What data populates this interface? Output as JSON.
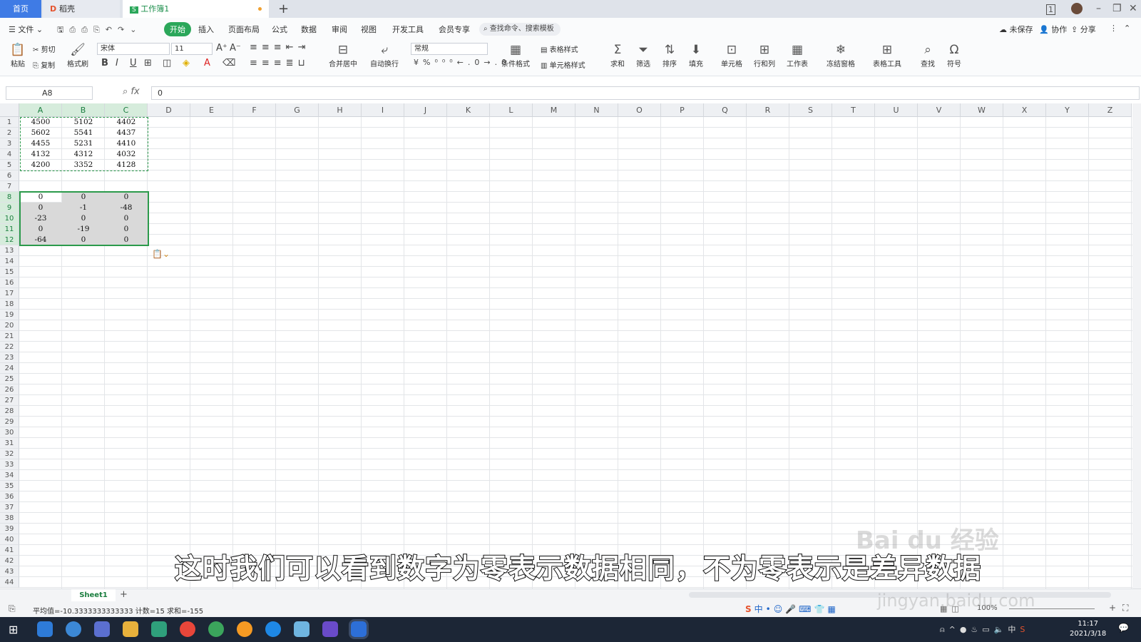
{
  "tabs": {
    "home": "首页",
    "daoke": "稻壳",
    "workbook": "工作簿1"
  },
  "menu": {
    "file": "文件",
    "start": "开始",
    "insert": "插入",
    "layout": "页面布局",
    "formula": "公式",
    "data": "数据",
    "review": "审阅",
    "view": "视图",
    "dev": "开发工具",
    "vip": "会员专享",
    "search_placeholder": "查找命令、搜索模板",
    "unsaved": "未保存",
    "collab": "协作",
    "share": "分享"
  },
  "toolbar": {
    "paste": "粘贴",
    "cut": "剪切",
    "copy": "复制",
    "format_painter": "格式刷",
    "font": "宋体",
    "font_size": "11",
    "merge": "合并居中",
    "wrap": "自动换行",
    "number_format": "常规",
    "cond_format": "条件格式",
    "table_style": "表格样式",
    "cell_style": "单元格样式",
    "sum": "求和",
    "filter": "筛选",
    "sort": "排序",
    "fill": "填充",
    "cell": "单元格",
    "rowcol": "行和列",
    "worksheet": "工作表",
    "freeze": "冻结窗格",
    "table_tools": "表格工具",
    "find": "查找",
    "symbol": "符号"
  },
  "formula_bar": {
    "name_box": "A8",
    "value": "0"
  },
  "columns": [
    "A",
    "B",
    "C",
    "D",
    "E",
    "F",
    "G",
    "H",
    "I",
    "J",
    "K",
    "L",
    "M",
    "N",
    "O",
    "P",
    "Q",
    "R",
    "S",
    "T",
    "U",
    "V",
    "W",
    "X",
    "Y",
    "Z"
  ],
  "cells": {
    "A1": "4500",
    "B1": "5102",
    "C1": "4402",
    "A2": "5602",
    "B2": "5541",
    "C2": "4437",
    "A3": "4455",
    "B3": "5231",
    "C3": "4410",
    "A4": "4132",
    "B4": "4312",
    "C4": "4032",
    "A5": "4200",
    "B5": "3352",
    "C5": "4128",
    "A8": "0",
    "B8": "0",
    "C8": "0",
    "A9": "0",
    "B9": "-1",
    "C9": "-48",
    "A10": "-23",
    "B10": "0",
    "C10": "0",
    "A11": "0",
    "B11": "-19",
    "C11": "0",
    "A12": "-64",
    "B12": "0",
    "C12": "0"
  },
  "sheet": {
    "name": "Sheet1"
  },
  "status": "平均值=-10.3333333333333  计数=15  求和=-155",
  "zoom": "100%",
  "clock": {
    "time": "11:17",
    "date": "2021/3/18"
  },
  "subtitle": "这时我们可以看到数字为零表示数据相同，不为零表示是差异数据",
  "watermark": "Bai du 经验",
  "watermark_url": "jingyan.baidu.com"
}
